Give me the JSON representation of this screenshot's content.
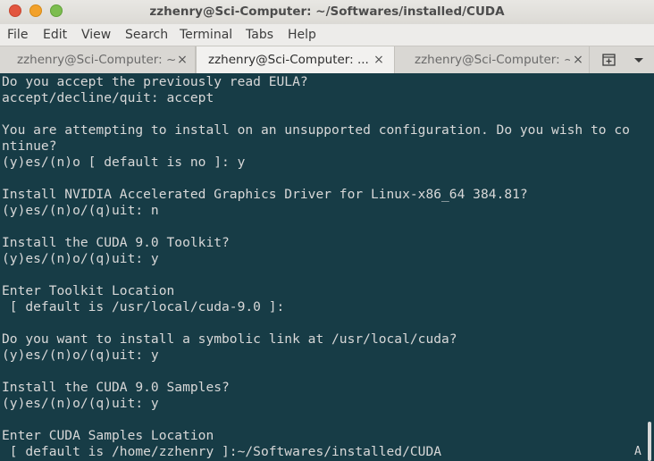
{
  "window": {
    "title": "zzhenry@Sci-Computer: ~/Softwares/installed/CUDA"
  },
  "menu": {
    "items": [
      "File",
      "Edit",
      "View",
      "Search",
      "Terminal",
      "Tabs",
      "Help"
    ]
  },
  "tabs": [
    {
      "label": "zzhenry@Sci-Computer: ~",
      "active": false
    },
    {
      "label": "zzhenry@Sci-Computer: ...",
      "active": true
    },
    {
      "label": "zzhenry@Sci-Computer: ~",
      "active": false
    }
  ],
  "icons": {
    "close_tab": "×",
    "new_tab": "new-tab-icon",
    "tab_menu": "chevron-down-icon"
  },
  "terminal": {
    "lines": [
      "Do you accept the previously read EULA?",
      "accept/decline/quit: accept",
      "",
      "You are attempting to install on an unsupported configuration. Do you wish to co",
      "ntinue?",
      "(y)es/(n)o [ default is no ]: y",
      "",
      "Install NVIDIA Accelerated Graphics Driver for Linux-x86_64 384.81?",
      "(y)es/(n)o/(q)uit: n",
      "",
      "Install the CUDA 9.0 Toolkit?",
      "(y)es/(n)o/(q)uit: y",
      "",
      "Enter Toolkit Location",
      " [ default is /usr/local/cuda-9.0 ]:",
      "",
      "Do you want to install a symbolic link at /usr/local/cuda?",
      "(y)es/(n)o/(q)uit: y",
      "",
      "Install the CUDA 9.0 Samples?",
      "(y)es/(n)o/(q)uit: y",
      "",
      "Enter CUDA Samples Location",
      " [ default is /home/zzhenry ]:~/Softwares/installed/CUDA"
    ],
    "corner_indicator": "A"
  },
  "colors": {
    "terminal_bg": "#173c46",
    "terminal_fg": "#d8d8d8",
    "close_button": "#e2563f",
    "minimize_button": "#f2a12a",
    "maximize_button": "#7cbd4f"
  }
}
